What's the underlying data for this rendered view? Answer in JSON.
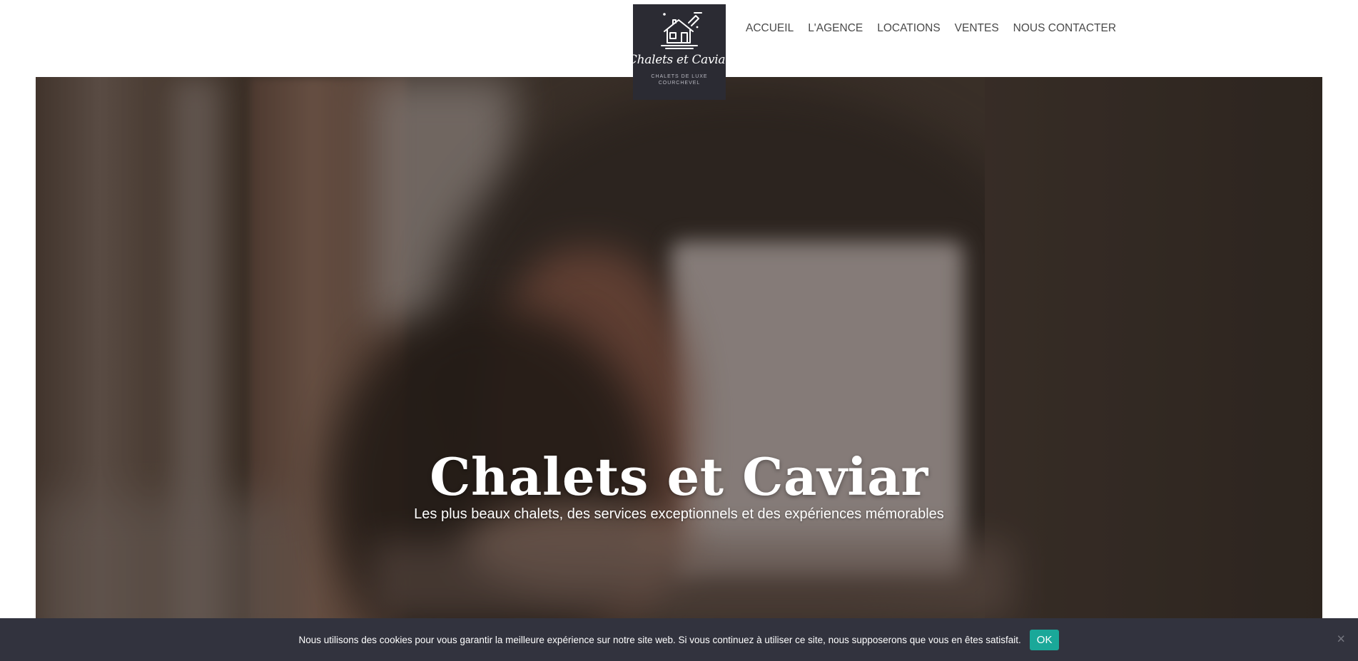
{
  "logo": {
    "name": "Chalets et Caviar",
    "tagline1": "CHALETS DE LUXE",
    "tagline2": "COURCHEVEL"
  },
  "nav": {
    "items": [
      "ACCUEIL",
      "L'AGENCE",
      "LOCATIONS",
      "VENTES",
      "NOUS CONTACTER"
    ]
  },
  "hero": {
    "title": "Chalets et Caviar",
    "subtitle": "Les plus beaux chalets, des services exceptionnels et des expériences mémorables"
  },
  "cookie": {
    "text": "Nous utilisons des cookies pour vous garantir la meilleure expérience sur notre site web. Si vous continuez à utiliser ce site, nous supposerons que vous en êtes satisfait.",
    "ok_label": "OK",
    "close_glyph": "×"
  },
  "colors": {
    "logo_bg": "#2b2b33",
    "cookie_bg": "#32333e",
    "ok_button": "#1aa899",
    "nav_text": "#4a4a4a"
  },
  "icons": [
    "house-logo-icon",
    "close-icon"
  ]
}
